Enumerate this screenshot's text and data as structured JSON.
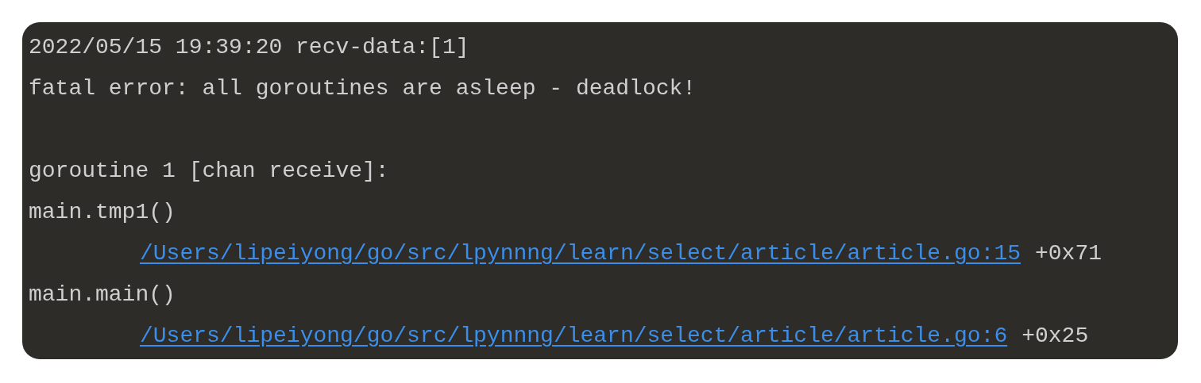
{
  "terminal": {
    "lines": [
      {
        "kind": "text",
        "text": "2022/05/15 19:39:20 recv-data:[1]"
      },
      {
        "kind": "text",
        "text": "fatal error: all goroutines are asleep - deadlock!"
      },
      {
        "kind": "blank"
      },
      {
        "kind": "text",
        "text": "goroutine 1 [chan receive]:"
      },
      {
        "kind": "text",
        "text": "main.tmp1()"
      },
      {
        "kind": "frame",
        "link": "/Users/lipeiyong/go/src/lpynnng/learn/select/article/article.go:15",
        "offset": "+0x71"
      },
      {
        "kind": "text",
        "text": "main.main()"
      },
      {
        "kind": "frame",
        "link": "/Users/lipeiyong/go/src/lpynnng/learn/select/article/article.go:6",
        "offset": "+0x25"
      }
    ]
  }
}
